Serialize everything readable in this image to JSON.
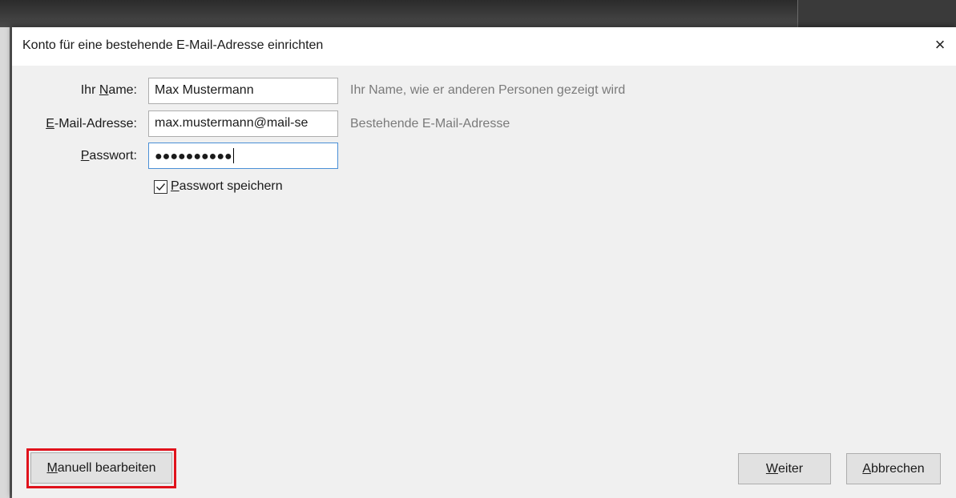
{
  "dialog": {
    "title": "Konto für eine bestehende E-Mail-Adresse einrichten",
    "close_icon": "×"
  },
  "form": {
    "name": {
      "label_prefix": "Ihr ",
      "label_underlined": "N",
      "label_rest": "ame:",
      "value": "Max Mustermann",
      "hint": "Ihr Name, wie er anderen Personen gezeigt wird"
    },
    "email": {
      "label_underlined": "E",
      "label_rest": "-Mail-Adresse:",
      "value": "max.mustermann@mail-se",
      "hint": "Bestehende E-Mail-Adresse"
    },
    "password": {
      "label_underlined": "P",
      "label_rest": "asswort:",
      "value_masked": "●●●●●●●●●●"
    },
    "save_password": {
      "label_underlined": "P",
      "label_rest": "asswort speichern",
      "checked": true
    }
  },
  "buttons": {
    "manual": {
      "first": "M",
      "rest": "anuell bearbeiten"
    },
    "next": {
      "first": "W",
      "rest": "eiter"
    },
    "cancel": {
      "first": "A",
      "rest": "bbrechen"
    }
  },
  "colors": {
    "highlight": "#e0121c",
    "focus_border": "#4a8fd6"
  }
}
